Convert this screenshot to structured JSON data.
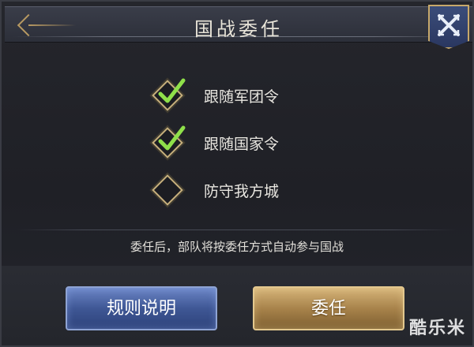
{
  "header": {
    "title": "国战委任"
  },
  "options": [
    {
      "label": "跟随军团令",
      "checked": true
    },
    {
      "label": "跟随国家令",
      "checked": true
    },
    {
      "label": "防守我方城",
      "checked": false
    }
  ],
  "hint": "委任后，部队将按委任方式自动参与国战",
  "buttons": {
    "rules": "规则说明",
    "appoint": "委任"
  },
  "watermark": "酷乐米",
  "colors": {
    "accent_gold": "#c7a86a",
    "check_green": "#8fe04a",
    "rules_blue": "#3f5795"
  }
}
